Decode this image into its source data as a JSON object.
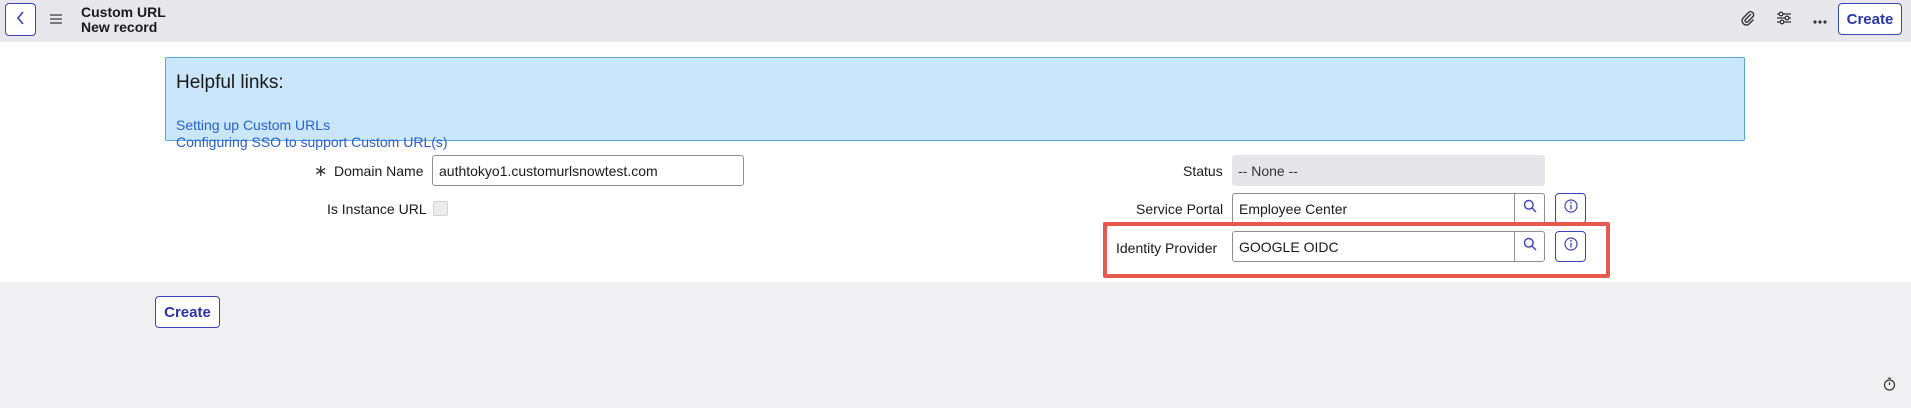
{
  "header": {
    "title": "Custom URL",
    "subtitle": "New record",
    "icons": [
      "back-icon",
      "hamburger-menu-icon",
      "attachment-icon",
      "settings-sliders-icon",
      "more-options-icon"
    ],
    "create_label": "Create"
  },
  "helpful_links": {
    "heading": "Helpful links:",
    "links": [
      "Setting up Custom URLs",
      "Configuring SSO to support Custom URL(s)"
    ]
  },
  "form": {
    "domain_name": {
      "label": "Domain Name",
      "required_marker": "∗",
      "value": "authtokyo1.customurlsnowtest.com"
    },
    "is_instance_url": {
      "label": "Is Instance URL",
      "checked": false
    },
    "status": {
      "label": "Status",
      "value": "-- None --"
    },
    "service_portal": {
      "label": "Service Portal",
      "value": "Employee Center"
    },
    "identity_provider": {
      "label": "Identity Provider",
      "value": "GOOGLE OIDC"
    }
  },
  "footer": {
    "create_label": "Create"
  },
  "colors": {
    "accent": "#3b44b8",
    "highlight": "#e5594f",
    "info_bg": "#c9e6fb"
  }
}
